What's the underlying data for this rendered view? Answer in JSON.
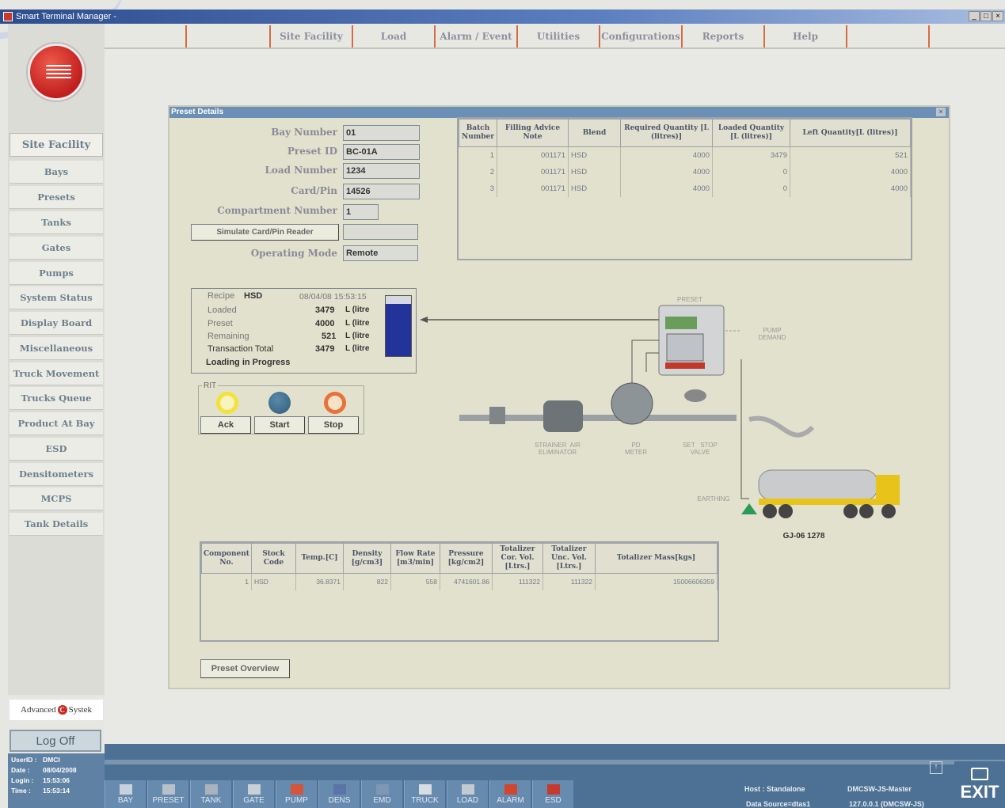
{
  "window": {
    "title": "Smart Terminal Manager -",
    "buttons": [
      "_",
      "□",
      "×"
    ]
  },
  "menu": [
    {
      "label": ""
    },
    {
      "label": "Site Facility"
    },
    {
      "label": "Load"
    },
    {
      "label": "Alarm / Event"
    },
    {
      "label": "Utilities"
    },
    {
      "label": "Configurations"
    },
    {
      "label": "Reports"
    },
    {
      "label": "Help"
    },
    {
      "label": ""
    }
  ],
  "sidebar": {
    "heading": "Site Facility",
    "items": [
      {
        "label": "Bays"
      },
      {
        "label": "Presets"
      },
      {
        "label": "Tanks"
      },
      {
        "label": "Gates"
      },
      {
        "label": "Pumps"
      },
      {
        "label": "System Status"
      },
      {
        "label": "Display Board"
      },
      {
        "label": "Miscellaneous"
      },
      {
        "label": "Truck Movement"
      },
      {
        "label": "Trucks Queue"
      },
      {
        "label": "Product At Bay"
      },
      {
        "label": "ESD"
      },
      {
        "label": "Densitometers"
      },
      {
        "label": "MCPS"
      },
      {
        "label": "Tank Details"
      }
    ],
    "brand": {
      "part1": "Advanced",
      "part2": "Systek"
    },
    "logoff": "Log Off",
    "user": {
      "userid_label": "UserID :",
      "userid": "DMCI",
      "date_label": "Date :",
      "date": "08/04/2008",
      "login_label": "Login :",
      "login": "15:53:06",
      "time_label": "Time :",
      "time": "15:53:14"
    }
  },
  "panel": {
    "title": "Preset Details",
    "close": "×",
    "form": {
      "bay_number_label": "Bay Number",
      "bay_number": "01",
      "preset_id_label": "Preset ID",
      "preset_id": "BC-01A",
      "load_number_label": "Load Number",
      "load_number": "1234",
      "card_pin_label": "Card/Pin",
      "card_pin": "14526",
      "compartment_label": "Compartment Number",
      "compartment": "1",
      "simulate_button": "Simulate Card/Pin Reader",
      "simulate_value": "",
      "operating_mode_label": "Operating Mode",
      "operating_mode": "Remote"
    },
    "batch_table": {
      "headers": [
        "Batch Number",
        "Filling Advice Note",
        "Blend",
        "Required Quantity [L (litres)]",
        "Loaded Quantity [L (litres)]",
        "Left Quantity[L (litres)]"
      ],
      "rows": [
        [
          "1",
          "001171",
          "HSD",
          "4000",
          "3479",
          "521"
        ],
        [
          "2",
          "001171",
          "HSD",
          "4000",
          "0",
          "4000"
        ],
        [
          "3",
          "001171",
          "HSD",
          "4000",
          "0",
          "4000"
        ]
      ]
    },
    "recipe": {
      "recipe_label": "Recipe",
      "recipe": "HSD",
      "datetime": "08/04/08  15:53:15",
      "loaded_label": "Loaded",
      "loaded": "3479",
      "preset_label": "Preset",
      "preset": "4000",
      "remaining_label": "Remaining",
      "remaining": "521",
      "total_label": "Transaction Total",
      "total": "3479",
      "unit": "L (litre",
      "status": "Loading in Progress",
      "fill_fraction": 0.87
    },
    "rit": {
      "label": "RIT",
      "ack": "Ack",
      "start": "Start",
      "stop": "Stop",
      "ack_color": "#f2e23a",
      "start_color": "#2f5c7a",
      "stop_color": "#e8733a"
    },
    "diagram": {
      "preset": "PRESET",
      "pump_demand": "PUMP\nDEMAND",
      "strainer": "STRAINER  AIR\nELIMINATOR",
      "pd_meter": "PD\nMETER",
      "set_stop": "SET   STOP\nVALVE",
      "earthing": "EARTHING",
      "truck_plate": "GJ-06 1278"
    },
    "component_table": {
      "headers": [
        "Component No.",
        "Stock Code",
        "Temp.[C]",
        "Density [g/cm3]",
        "Flow Rate [m3/min]",
        "Pressure [kg/cm2]",
        "Totalizer Cor. Vol. [Ltrs.]",
        "Totalizer Unc. Vol. [Ltrs.]",
        "Totalizer Mass[kgs]"
      ],
      "rows": [
        [
          "1",
          "HSD",
          "36.8371",
          "822",
          "558",
          "4741601.86",
          "111322",
          "111322",
          "15006606359"
        ]
      ]
    },
    "overview_button": "Preset Overview"
  },
  "toolbar": {
    "buttons": [
      {
        "label": "BAY"
      },
      {
        "label": "PRESET"
      },
      {
        "label": "TANK"
      },
      {
        "label": "GATE"
      },
      {
        "label": "PUMP"
      },
      {
        "label": "DENS"
      },
      {
        "label": "EMD"
      },
      {
        "label": "TRUCK"
      },
      {
        "label": "LOAD"
      },
      {
        "label": "ALARM"
      },
      {
        "label": "ESD"
      }
    ],
    "host_label": "Host : Standalone",
    "host_value": "DMCSW-JS-Master",
    "source_label": "Data Source=dtas1",
    "source_value": "127.0.0.1 (DMCSW-JS)",
    "exit": "EXIT"
  },
  "colors": {
    "accent_red": "#c8261f",
    "menu_divider": "#d76b45",
    "statusbar": "#4d7194"
  }
}
